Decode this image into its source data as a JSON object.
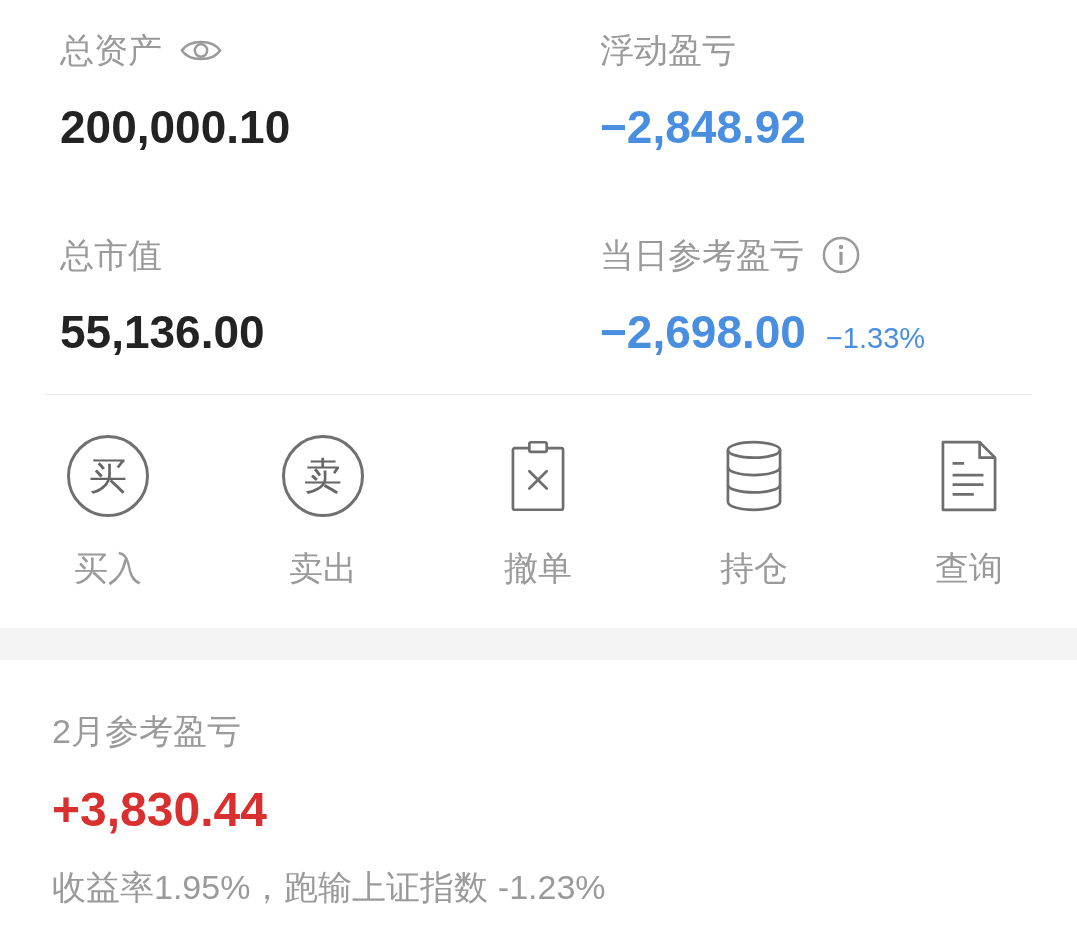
{
  "summary": [
    {
      "label": "总资产",
      "kind": "hideable",
      "value": "200,000.10",
      "color": "#232323"
    },
    {
      "label": "浮动盈亏",
      "kind": "plain",
      "value": "−2,848.92",
      "color": "#4a8fdf"
    },
    {
      "label": "总市值",
      "kind": "plain",
      "value": "55,136.00",
      "color": "#232323"
    },
    {
      "label": "当日参考盈亏",
      "kind": "info",
      "value": "−2,698.00",
      "change": "−1.33%",
      "color": "#4a8fdf"
    }
  ],
  "actions": [
    {
      "kind": "glyph",
      "glyph": "买",
      "label": "买入"
    },
    {
      "kind": "glyph",
      "glyph": "卖",
      "label": "卖出"
    },
    {
      "kind": "cancel",
      "label": "撤单"
    },
    {
      "kind": "positions",
      "label": "持仓"
    },
    {
      "kind": "query",
      "label": "查询"
    }
  ],
  "monthly": {
    "title": "2月参考盈亏",
    "value": "+3,830.44",
    "color": "#d9302f",
    "summary": "收益率1.95%，跑输上证指数 -1.23%"
  }
}
